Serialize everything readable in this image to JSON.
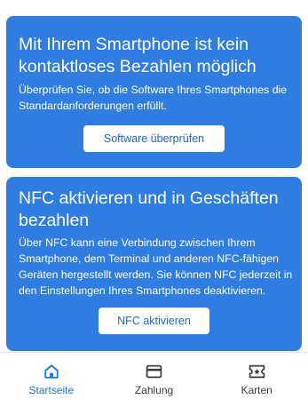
{
  "cards": [
    {
      "title": "Mit Ihrem Smartphone ist kein\nkontaktloses Bezahlen möglich",
      "text": "Überprüfen Sie, ob die Software Ihres Smartphones die\nStandardanforderungen erfüllt.",
      "button_label": "Software überprüfen"
    },
    {
      "title": "NFC aktivieren und in Geschäften\nbezahlen",
      "text": "Über NFC kann eine Verbindung zwischen Ihrem\nSmartphone, dem Terminal und anderen NFC-fähigen\nGeräten hergestellt werden. Sie können NFC jederzeit in\nden Einstellungen Ihres Smartphones deaktivieren.",
      "button_label": "NFC aktivieren"
    }
  ],
  "bottom_nav": {
    "items": [
      {
        "label": "Startseite",
        "icon": "home-icon",
        "active": true
      },
      {
        "label": "Zahlung",
        "icon": "payment-card-icon",
        "active": false
      },
      {
        "label": "Karten",
        "icon": "pass-ticket-icon",
        "active": false
      }
    ]
  },
  "colors": {
    "card_background": "#2f7de1",
    "accent": "#1a73e8",
    "button_text": "#1a66c9"
  }
}
